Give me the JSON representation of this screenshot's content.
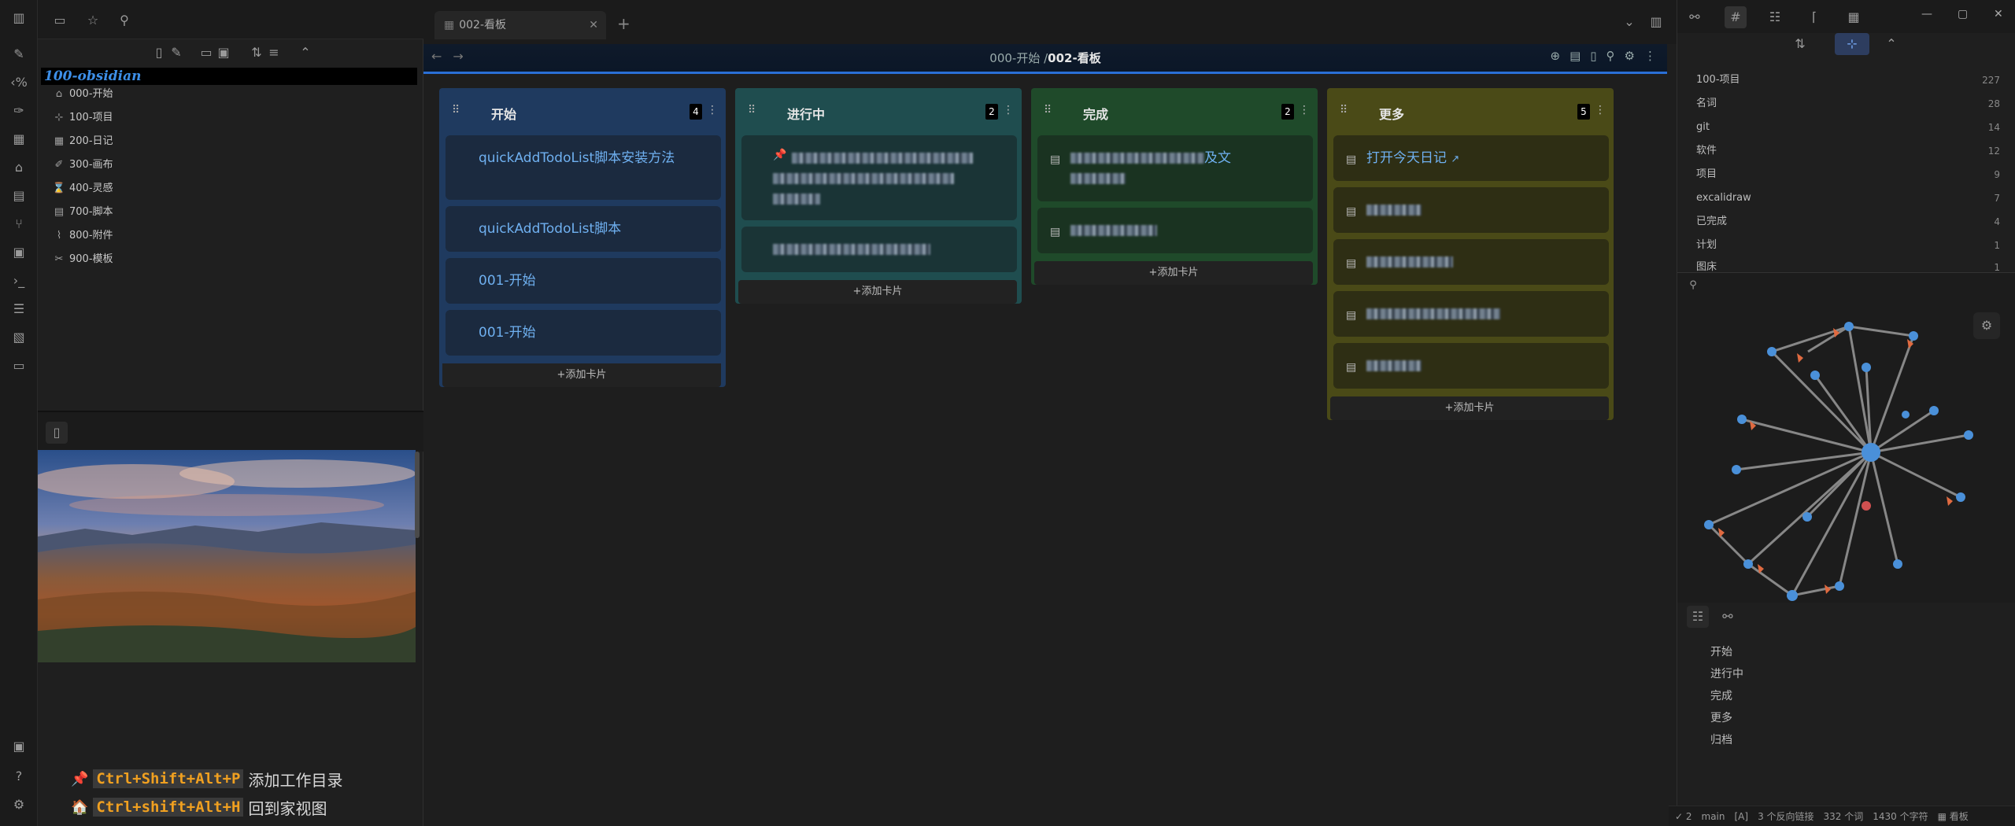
{
  "tab": {
    "title": "002-看板",
    "close": "✕",
    "add": "+"
  },
  "breadcrumb": {
    "parent": "000-开始",
    "sep": " /",
    "current": "002-看板"
  },
  "vault": {
    "name": "100-obsidian"
  },
  "tree": [
    {
      "label": "000-开始",
      "icon": "home-icon"
    },
    {
      "label": "100-项目",
      "icon": "project-icon"
    },
    {
      "label": "200-日记",
      "icon": "calendar-icon"
    },
    {
      "label": "300-画布",
      "icon": "brush-icon"
    },
    {
      "label": "400-灵感",
      "icon": "hourglass-icon"
    },
    {
      "label": "700-脚本",
      "icon": "script-icon"
    },
    {
      "label": "800-附件",
      "icon": "attachment-icon"
    },
    {
      "label": "900-模板",
      "icon": "template-icon"
    }
  ],
  "hotkeys": [
    {
      "emoji": "📌",
      "keys": "Ctrl+Shift+Alt+P",
      "desc": "添加工作目录"
    },
    {
      "emoji": "🏠",
      "keys": "Ctrl+shift+Alt+H",
      "desc": "回到家视图"
    }
  ],
  "board": {
    "add_card_label": "+添加卡片",
    "lanes": [
      {
        "title": "开始",
        "count": "4",
        "color": "#1f3a5f",
        "card_bg": "#1b2a3f",
        "text_color": "#6fb0f0",
        "cards": [
          "quickAddTodoList脚本安装方法",
          "quickAddTodoList脚本",
          "001-开始",
          "001-开始"
        ]
      },
      {
        "title": "进行中",
        "count": "2",
        "color": "#1f4d4f",
        "card_bg": "#1a3436",
        "text_color": "#6fb0f0",
        "cards": []
      },
      {
        "title": "完成",
        "count": "2",
        "color": "#1f4a2a",
        "card_bg": "#1a3321",
        "text_color": "#6fb0f0",
        "cards": []
      },
      {
        "title": "更多",
        "count": "5",
        "color": "#4a4a17",
        "card_bg": "#2e2e14",
        "text_color": "#6fb0f0",
        "cards": [
          "打开今天日记"
        ]
      }
    ],
    "lane2_partial": "及文"
  },
  "tags": [
    {
      "name": "100-项目",
      "count": "227"
    },
    {
      "name": "名词",
      "count": "28"
    },
    {
      "name": "git",
      "count": "14"
    },
    {
      "name": "软件",
      "count": "12"
    },
    {
      "name": "项目",
      "count": "9"
    },
    {
      "name": "excalidraw",
      "count": "7"
    },
    {
      "name": "已完成",
      "count": "4"
    },
    {
      "name": "计划",
      "count": "1"
    },
    {
      "name": "图床",
      "count": "1"
    }
  ],
  "outline": [
    "开始",
    "进行中",
    "完成",
    "更多",
    "归档"
  ],
  "status": {
    "a": "2",
    "b": "main",
    "c": "[A]",
    "d": "3 个反向链接",
    "e": "332 个词",
    "f": "1430 个字符",
    "g": "看板"
  }
}
